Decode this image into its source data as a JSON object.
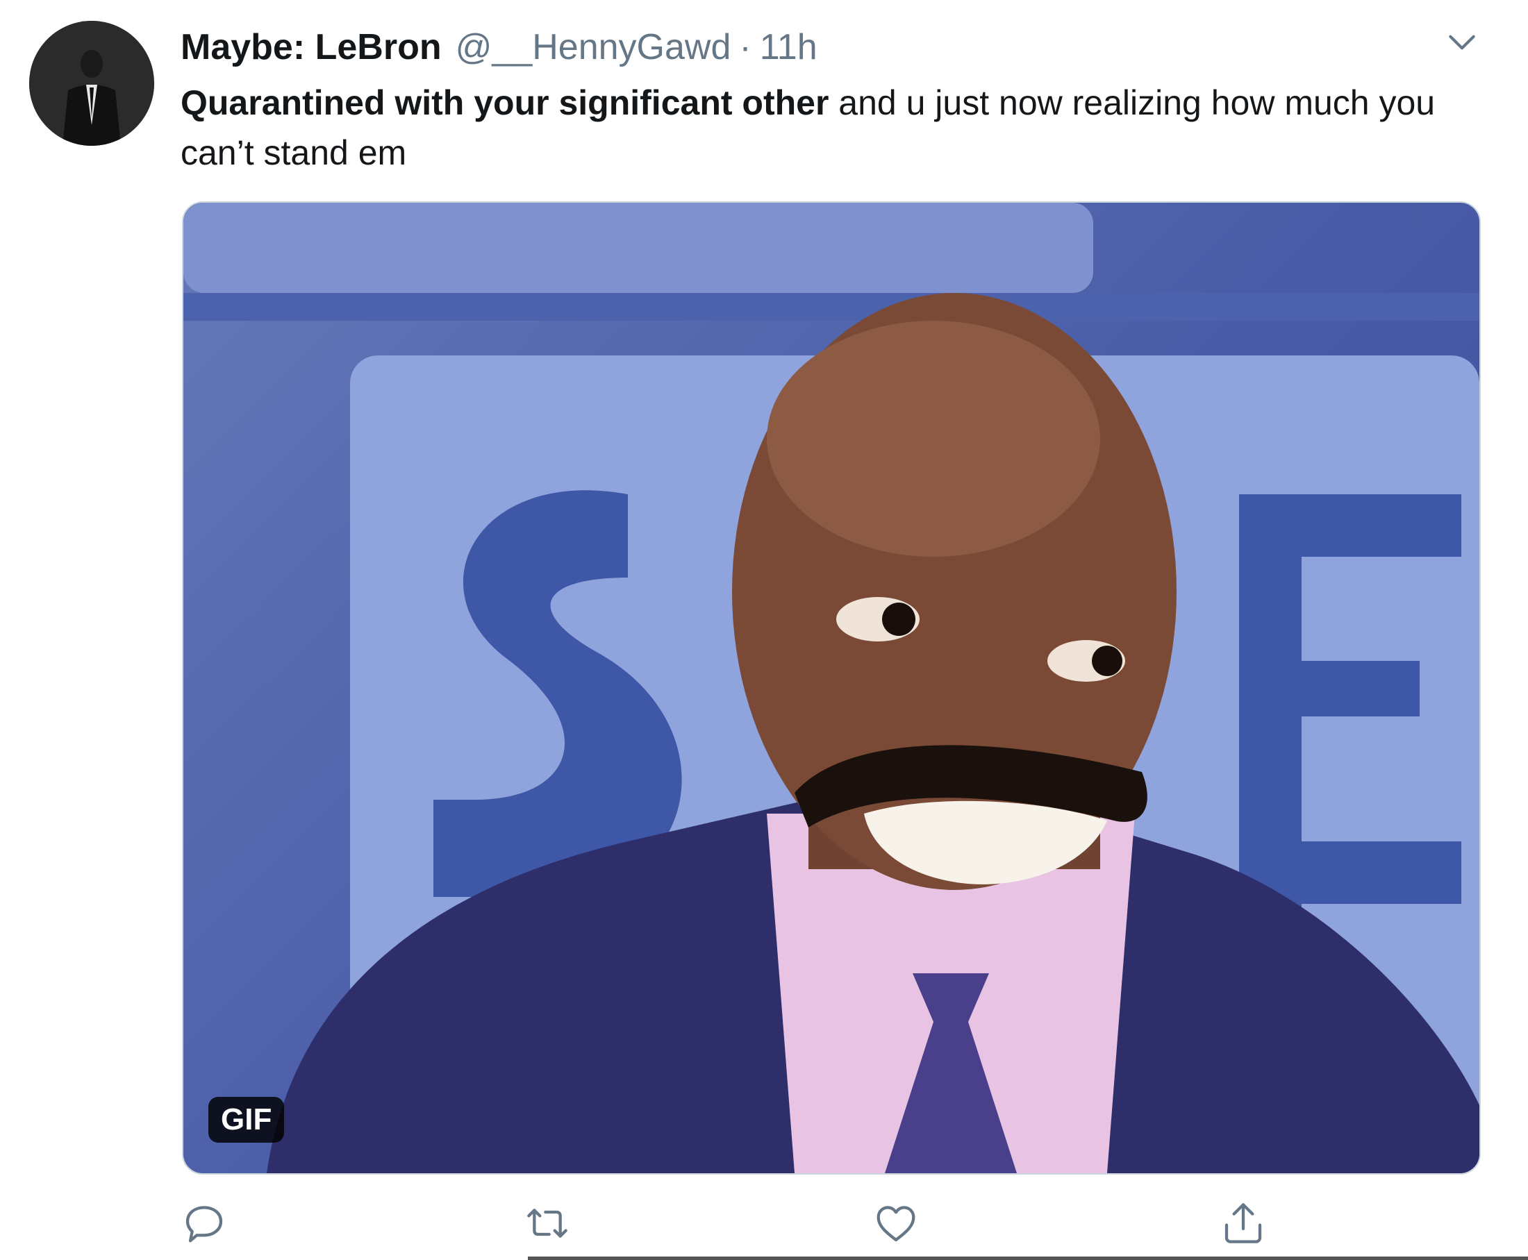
{
  "tweet": {
    "display_name": "Maybe: LeBron",
    "handle": "@__HennyGawd",
    "separator": "·",
    "time": "11h",
    "text_bold": "Quarantined with your significant other",
    "text_rest": " and u just now realizing how much you can’t stand em",
    "media": {
      "badge": "GIF",
      "colors": {
        "background": "#4a5da8",
        "panel": "#8fa3dc",
        "suit": "#2e2f6a",
        "skin": "#7a4a36"
      }
    },
    "actions": {
      "reply_icon": "reply-icon",
      "retweet_icon": "retweet-icon",
      "like_icon": "like-icon",
      "share_icon": "share-icon"
    },
    "colors": {
      "name": "#14171a",
      "secondary": "#657786",
      "icon": "#657786"
    }
  }
}
